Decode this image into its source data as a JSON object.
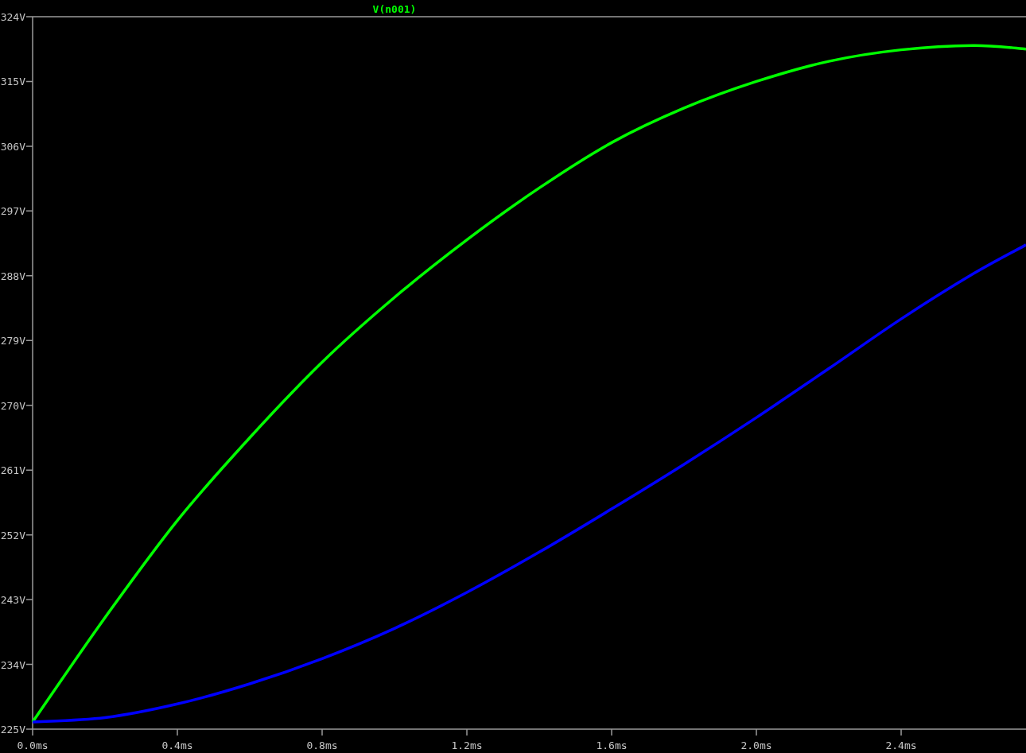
{
  "plot": {
    "chart_data": {
      "type": "line",
      "x": [
        0,
        0.2,
        0.4,
        0.6,
        0.8,
        1.0,
        1.2,
        1.4,
        1.6,
        1.8,
        2.0,
        2.2,
        2.4,
        2.6,
        2.745
      ],
      "series": [
        {
          "name": "V(n001)",
          "color": "#00ff00",
          "values": [
            226,
            240.5,
            254,
            265.5,
            276,
            285,
            293,
            300.2,
            306.5,
            311.3,
            315,
            317.8,
            319.4,
            320,
            319.5
          ]
        },
        {
          "color": "#0000ff",
          "values": [
            226,
            226.6,
            228.5,
            231.3,
            234.8,
            239,
            244,
            249.6,
            255.6,
            261.8,
            268.3,
            275.1,
            282,
            288.3,
            292.3
          ]
        }
      ],
      "xlim": [
        0,
        2.745
      ],
      "ylim": [
        225,
        324
      ],
      "xticks": [
        {
          "value": 0,
          "label": "0.0ms"
        },
        {
          "value": 0.4,
          "label": "0.4ms"
        },
        {
          "value": 0.8,
          "label": "0.8ms"
        },
        {
          "value": 1.2,
          "label": "1.2ms"
        },
        {
          "value": 1.6,
          "label": "1.6ms"
        },
        {
          "value": 2.0,
          "label": "2.0ms"
        },
        {
          "value": 2.4,
          "label": "2.4ms"
        }
      ],
      "yticks": [
        {
          "value": 225,
          "label": "225V"
        },
        {
          "value": 234,
          "label": "234V"
        },
        {
          "value": 243,
          "label": "243V"
        },
        {
          "value": 252,
          "label": "252V"
        },
        {
          "value": 261,
          "label": "261V"
        },
        {
          "value": 270,
          "label": "270V"
        },
        {
          "value": 279,
          "label": "279V"
        },
        {
          "value": 288,
          "label": "288V"
        },
        {
          "value": 297,
          "label": "297V"
        },
        {
          "value": 306,
          "label": "306V"
        },
        {
          "value": 315,
          "label": "315V"
        },
        {
          "value": 324,
          "label": "324V"
        }
      ]
    }
  }
}
